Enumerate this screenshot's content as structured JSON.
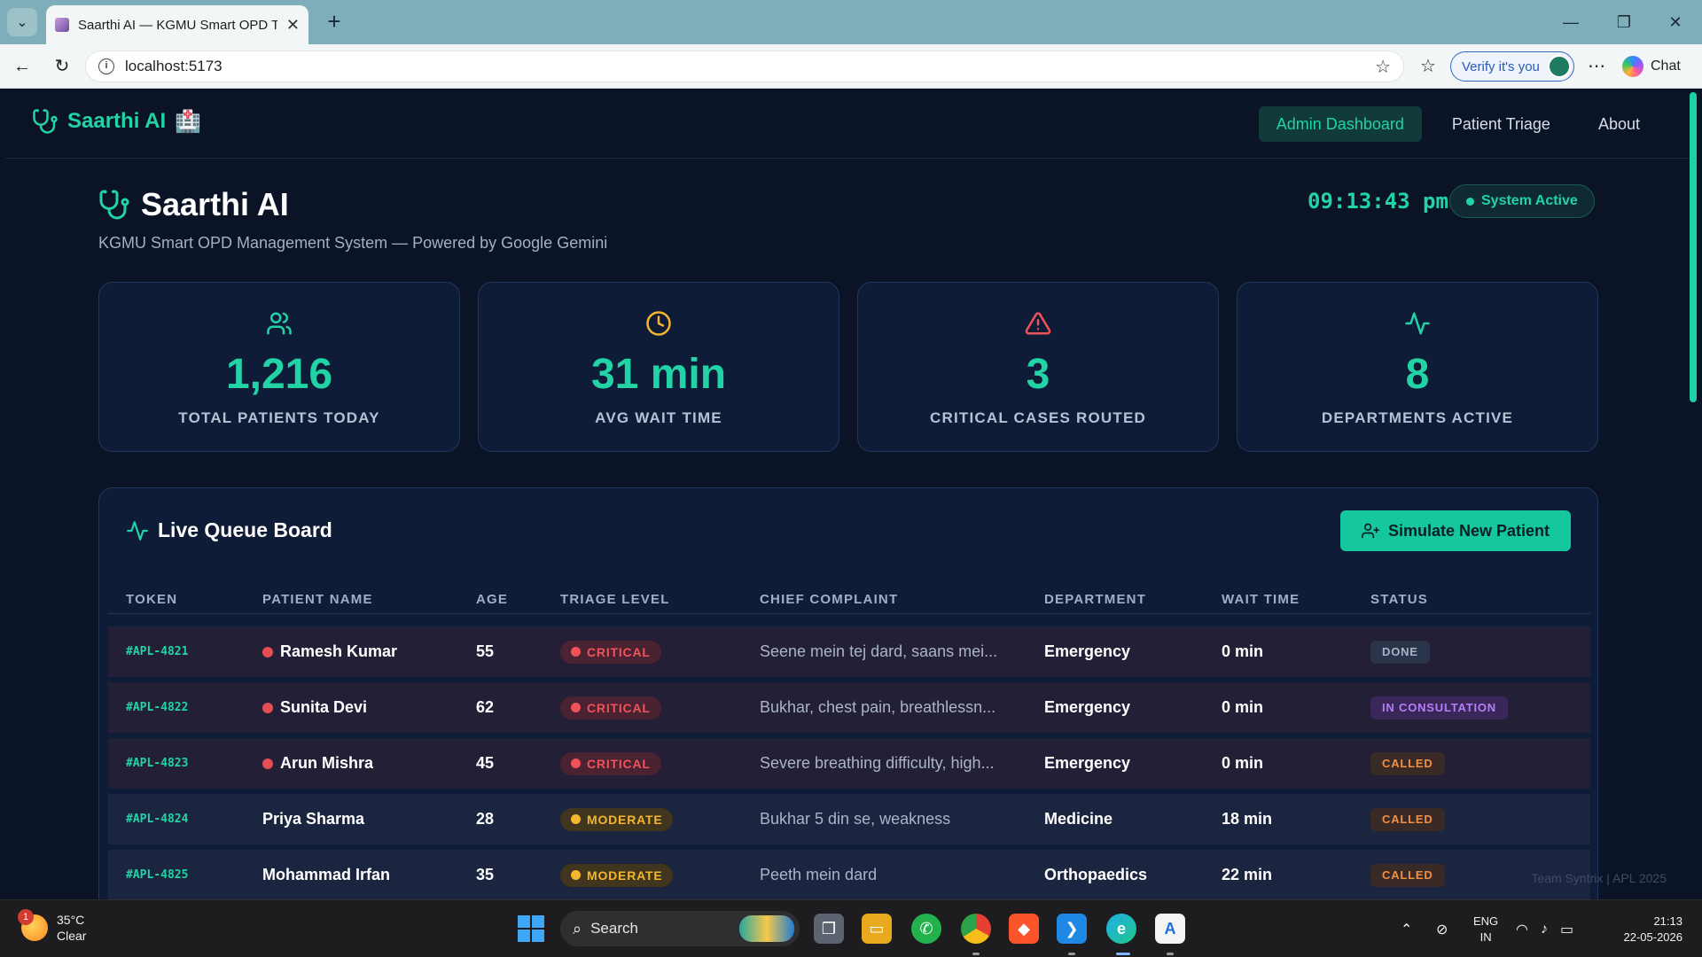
{
  "browser": {
    "tab_title": "Saarthi AI — KGMU Smart OPD Tri",
    "url": "localhost:5173",
    "verify_label": "Verify it's you",
    "chat_label": "Chat"
  },
  "nav": {
    "brand": "Saarthi AI",
    "brand_emoji": "🏥",
    "links": [
      {
        "label": "Admin Dashboard",
        "active": true
      },
      {
        "label": "Patient Triage",
        "active": false
      },
      {
        "label": "About",
        "active": false
      }
    ]
  },
  "header": {
    "title": "Saarthi AI",
    "subtitle": "KGMU Smart OPD Management System — Powered by Google Gemini",
    "clock": "09:13:43 pm",
    "status": "System Active"
  },
  "stats": [
    {
      "icon": "users-icon",
      "value": "1,216",
      "label": "TOTAL PATIENTS TODAY",
      "icon_color": "#22d3a6"
    },
    {
      "icon": "clock-icon",
      "value": "31 min",
      "label": "AVG WAIT TIME",
      "icon_color": "#f5b530"
    },
    {
      "icon": "alert-triangle-icon",
      "value": "3",
      "label": "CRITICAL CASES ROUTED",
      "icon_color": "#f0525a"
    },
    {
      "icon": "activity-icon",
      "value": "8",
      "label": "DEPARTMENTS ACTIVE",
      "icon_color": "#22d3a6"
    }
  ],
  "queue": {
    "title": "Live Queue Board",
    "simulate_label": "Simulate New Patient",
    "columns": [
      "TOKEN",
      "PATIENT NAME",
      "AGE",
      "TRIAGE LEVEL",
      "CHIEF COMPLAINT",
      "DEPARTMENT",
      "WAIT TIME",
      "STATUS"
    ],
    "rows": [
      {
        "token": "#APL-4821",
        "name": "Ramesh Kumar",
        "age": "55",
        "triage": "CRITICAL",
        "complaint": "Seene mein tej dard, saans mei...",
        "department": "Emergency",
        "wait": "0 min",
        "status": "DONE"
      },
      {
        "token": "#APL-4822",
        "name": "Sunita Devi",
        "age": "62",
        "triage": "CRITICAL",
        "complaint": "Bukhar, chest pain, breathlessn...",
        "department": "Emergency",
        "wait": "0 min",
        "status": "IN CONSULTATION"
      },
      {
        "token": "#APL-4823",
        "name": "Arun Mishra",
        "age": "45",
        "triage": "CRITICAL",
        "complaint": "Severe breathing difficulty, high...",
        "department": "Emergency",
        "wait": "0 min",
        "status": "CALLED"
      },
      {
        "token": "#APL-4824",
        "name": "Priya Sharma",
        "age": "28",
        "triage": "MODERATE",
        "complaint": "Bukhar 5 din se, weakness",
        "department": "Medicine",
        "wait": "18 min",
        "status": "CALLED"
      },
      {
        "token": "#APL-4825",
        "name": "Mohammad Irfan",
        "age": "35",
        "triage": "MODERATE",
        "complaint": "Peeth mein dard",
        "department": "Orthopaedics",
        "wait": "22 min",
        "status": "CALLED"
      }
    ]
  },
  "watermark": "Team Syntrix | APL 2025",
  "taskbar": {
    "weather_temp": "35°C",
    "weather_desc": "Clear",
    "weather_badge": "1",
    "search_label": "Search",
    "lang_top": "ENG",
    "lang_bottom": "IN",
    "time": "21:13",
    "date": "22-05-2026"
  },
  "colors": {
    "accent": "#22d3a6",
    "background": "#0b1426",
    "critical": "#f0525a",
    "moderate": "#f5b530"
  }
}
